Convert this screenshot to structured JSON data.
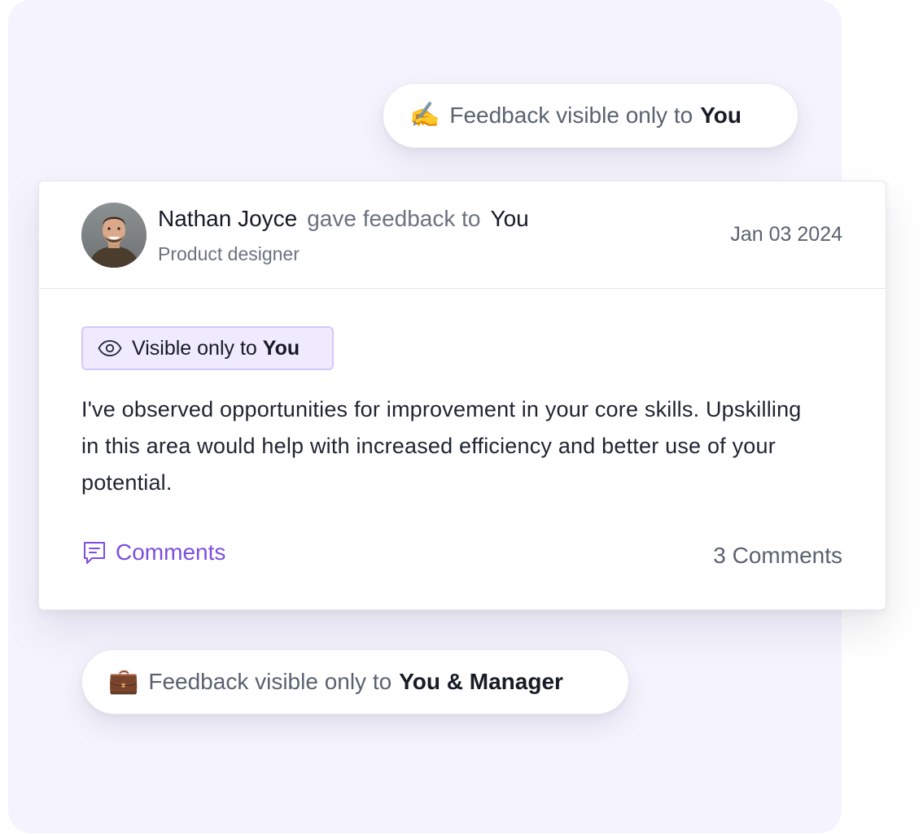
{
  "top_pill": {
    "emoji": "✍️",
    "prefix": "Feedback visible only to",
    "audience": "You"
  },
  "feedback_card": {
    "author": {
      "name": "Nathan Joyce",
      "action": "gave feedback to",
      "target": "You",
      "role": "Product designer"
    },
    "date": "Jan 03 2024",
    "visibility": {
      "icon": "eye-icon",
      "prefix": "Visible only to",
      "audience": "You"
    },
    "message": "I've observed opportunities for improvement in your core skills. Upskilling in this area would help with increased efficiency and better use of your potential.",
    "comments_label": "Comments",
    "comments_icon": "comment-icon",
    "comments_count": "3 Comments"
  },
  "bottom_pill": {
    "emoji": "💼",
    "prefix": "Feedback visible only to",
    "audience": "You & Manager"
  },
  "colors": {
    "accent": "#7c4fe0",
    "panel_background": "#f5f4fe",
    "badge_background": "#efeafe"
  }
}
